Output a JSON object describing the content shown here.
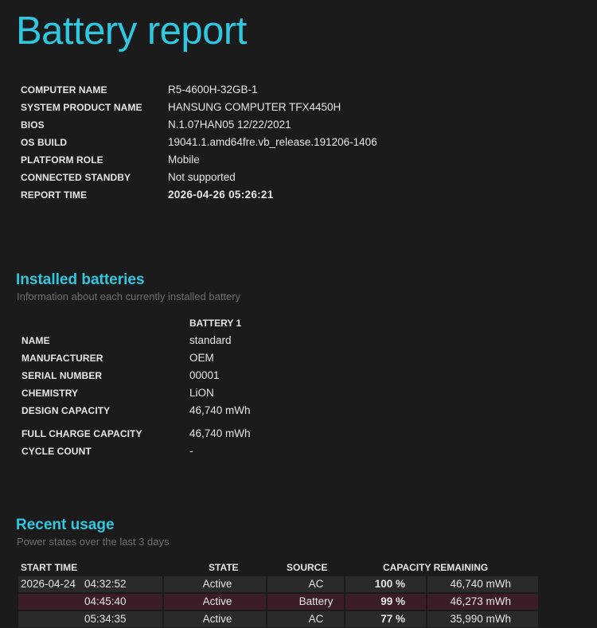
{
  "page": {
    "title": "Battery report"
  },
  "system_info": [
    {
      "label": "COMPUTER NAME",
      "value": "R5-4600H-32GB-1",
      "bold": false
    },
    {
      "label": "SYSTEM PRODUCT NAME",
      "value": "HANSUNG COMPUTER TFX4450H",
      "bold": false
    },
    {
      "label": "BIOS",
      "value": "N.1.07HAN05 12/22/2021",
      "bold": false
    },
    {
      "label": "OS BUILD",
      "value": "19041.1.amd64fre.vb_release.191206-1406",
      "bold": false
    },
    {
      "label": "PLATFORM ROLE",
      "value": "Mobile",
      "bold": false
    },
    {
      "label": "CONNECTED STANDBY",
      "value": "Not supported",
      "bold": false
    },
    {
      "label": "REPORT TIME",
      "value": "2026-04-26  05:26:21",
      "bold": true
    }
  ],
  "installed_batteries": {
    "title": "Installed batteries",
    "subtitle": "Information about each currently installed battery",
    "column_header": "BATTERY 1",
    "rows": [
      {
        "label": "NAME",
        "value": "standard"
      },
      {
        "label": "MANUFACTURER",
        "value": "OEM"
      },
      {
        "label": "SERIAL NUMBER",
        "value": "00001"
      },
      {
        "label": "CHEMISTRY",
        "value": "LiON"
      },
      {
        "label": "DESIGN CAPACITY",
        "value": "46,740 mWh"
      },
      {
        "label": "FULL CHARGE CAPACITY",
        "value": "46,740 mWh"
      },
      {
        "label": "CYCLE COUNT",
        "value": "-"
      }
    ]
  },
  "recent_usage": {
    "title": "Recent usage",
    "subtitle": "Power states over the last 3 days",
    "headers": {
      "start_time": "START TIME",
      "state": "STATE",
      "source": "SOURCE",
      "capacity": "CAPACITY REMAINING"
    },
    "rows": [
      {
        "date": "2026-04-24",
        "time": "04:32:52",
        "state": "Active",
        "source": "AC",
        "percent": "100 %",
        "capacity": "46,740 mWh"
      },
      {
        "date": "",
        "time": "04:45:40",
        "state": "Active",
        "source": "Battery",
        "percent": "99 %",
        "capacity": "46,273 mWh"
      },
      {
        "date": "",
        "time": "05:34:35",
        "state": "Active",
        "source": "AC",
        "percent": "77 %",
        "capacity": "35,990 mWh"
      }
    ]
  },
  "colors": {
    "background": "#1b1b1b",
    "accent": "#2fc8e0",
    "row_ac": "#2a2a2a",
    "row_battery": "#3b1d27"
  }
}
